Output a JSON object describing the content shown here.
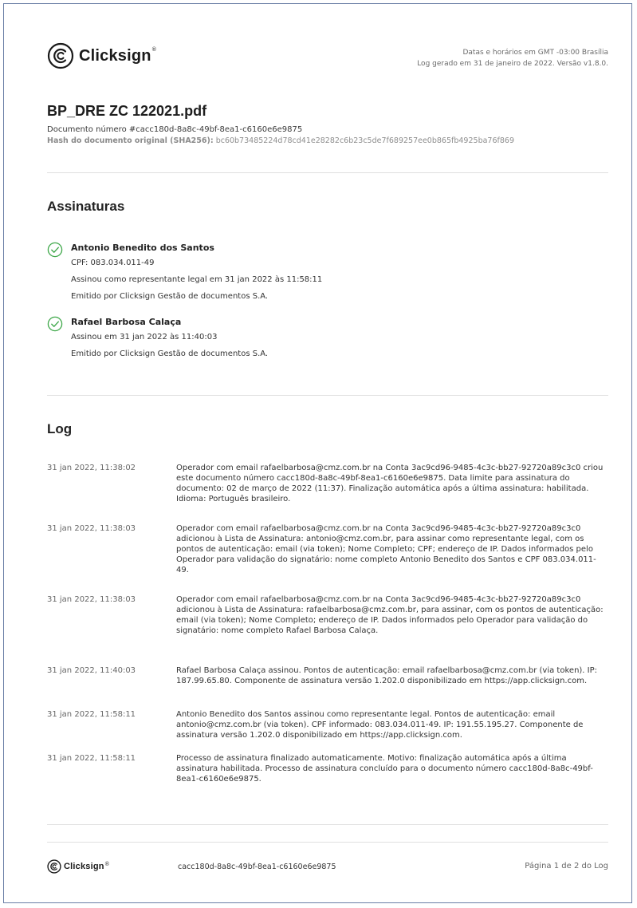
{
  "brand": {
    "name": "Clicksign",
    "reg": "®"
  },
  "header": {
    "timezone_note": "Datas e horários em GMT -03:00 Brasília",
    "generated_note": "Log gerado em 31 de janeiro de 2022. Versão v1.8.0."
  },
  "document": {
    "title": "BP_DRE ZC 122021.pdf",
    "number": "Documento número #cacc180d-8a8c-49bf-8ea1-c6160e6e9875",
    "hash_label": "Hash do documento original (SHA256):",
    "hash_value": "bc60b73485224d78cd41e28282c6b23c5de7f689257ee0b865fb4925ba76f869"
  },
  "signatures": {
    "title": "Assinaturas",
    "signers": [
      {
        "name": "Antonio Benedito dos Santos",
        "lines": [
          "CPF: 083.034.011-49",
          "Assinou como representante legal em 31 jan 2022 às 11:58:11",
          "Emitido por Clicksign Gestão de documentos S.A."
        ]
      },
      {
        "name": "Rafael Barbosa Calaça",
        "lines": [
          "Assinou em 31 jan 2022 às 11:40:03",
          "Emitido por Clicksign Gestão de documentos S.A."
        ]
      }
    ]
  },
  "log": {
    "title": "Log",
    "entries": [
      {
        "date": "31 jan 2022, 11:38:02",
        "text": "Operador com email rafaelbarbosa@cmz.com.br na Conta 3ac9cd96-9485-4c3c-bb27-92720a89c3c0 criou este documento número cacc180d-8a8c-49bf-8ea1-c6160e6e9875. Data limite para assinatura do documento: 02 de março de 2022 (11:37). Finalização automática após a última assinatura: habilitada. Idioma: Português brasileiro."
      },
      {
        "date": "31 jan 2022, 11:38:03",
        "text": "Operador com email rafaelbarbosa@cmz.com.br na Conta 3ac9cd96-9485-4c3c-bb27-92720a89c3c0 adicionou à Lista de Assinatura: antonio@cmz.com.br, para assinar como representante legal, com os pontos de autenticação: email (via token); Nome Completo; CPF; endereço de IP. Dados informados pelo Operador para validação do signatário: nome completo Antonio Benedito dos Santos e CPF 083.034.011-49."
      },
      {
        "date": "31 jan 2022, 11:38:03",
        "text": "Operador com email rafaelbarbosa@cmz.com.br na Conta 3ac9cd96-9485-4c3c-bb27-92720a89c3c0 adicionou à Lista de Assinatura: rafaelbarbosa@cmz.com.br, para assinar, com os pontos de autenticação: email (via token); Nome Completo; endereço de IP. Dados informados pelo Operador para validação do signatário: nome completo Rafael Barbosa Calaça."
      },
      {
        "date": "31 jan 2022, 11:40:03",
        "text": "Rafael Barbosa Calaça assinou. Pontos de autenticação: email rafaelbarbosa@cmz.com.br (via token). IP: 187.99.65.80. Componente de assinatura versão 1.202.0 disponibilizado em https://app.clicksign.com."
      },
      {
        "date": "31 jan 2022, 11:58:11",
        "text": "Antonio Benedito dos Santos assinou como representante legal. Pontos de autenticação: email antonio@cmz.com.br (via token). CPF informado: 083.034.011-49. IP: 191.55.195.27. Componente de assinatura versão 1.202.0 disponibilizado em https://app.clicksign.com."
      },
      {
        "date": "31 jan 2022, 11:58:11",
        "text": "Processo de assinatura finalizado automaticamente. Motivo: finalização automática após a última assinatura habilitada. Processo de assinatura concluído para o documento número cacc180d-8a8c-49bf-8ea1-c6160e6e9875."
      }
    ]
  },
  "footer": {
    "doc_id": "cacc180d-8a8c-49bf-8ea1-c6160e6e9875",
    "page_label": "Página 1 de 2 do Log"
  },
  "colors": {
    "check_green": "#3fa84a",
    "rule": "#e0e0e0",
    "frame": "#6b7fa6"
  }
}
